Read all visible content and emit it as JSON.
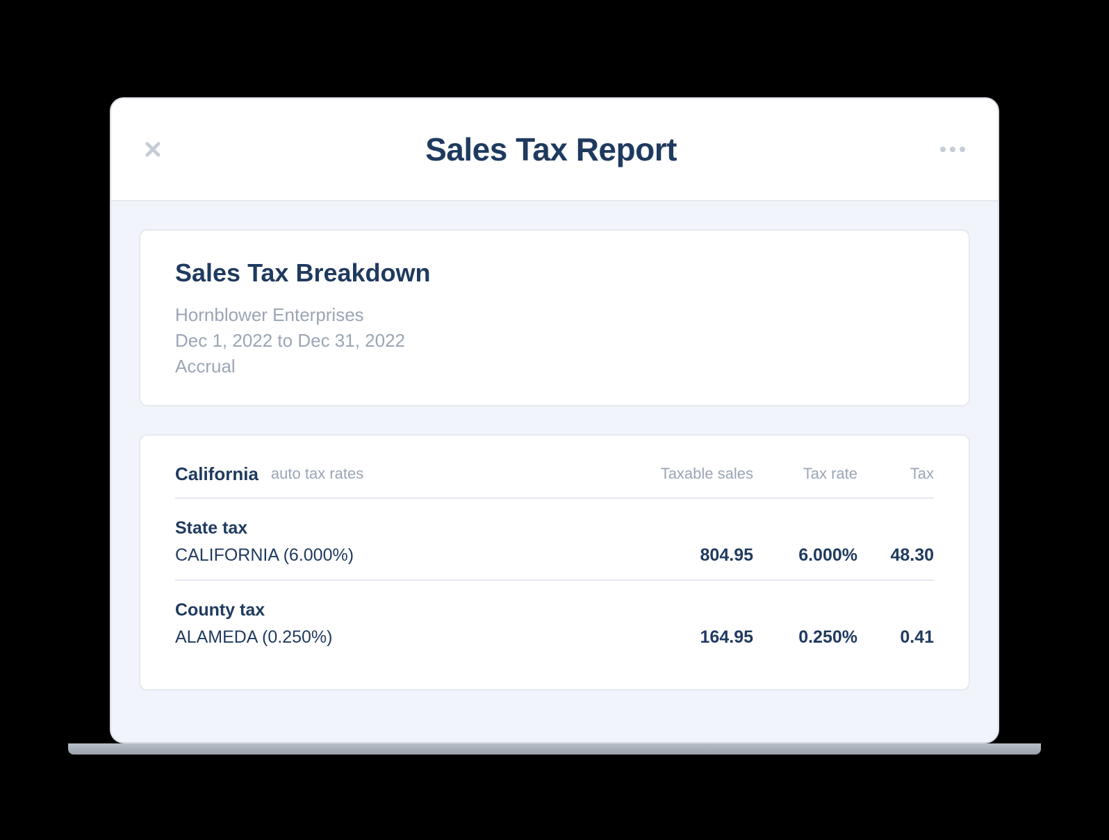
{
  "header": {
    "title": "Sales Tax Report"
  },
  "summary": {
    "title": "Sales Tax Breakdown",
    "company": "Hornblower Enterprises",
    "date_range": "Dec 1, 2022 to Dec 31, 2022",
    "method": "Accrual"
  },
  "table": {
    "state": "California",
    "rates_label": "auto tax rates",
    "columns": {
      "taxable": "Taxable sales",
      "rate": "Tax rate",
      "tax": "Tax"
    },
    "sections": [
      {
        "title": "State tax",
        "rows": [
          {
            "label": "CALIFORNIA (6.000%)",
            "taxable": "804.95",
            "rate": "6.000%",
            "tax": "48.30"
          }
        ]
      },
      {
        "title": "County tax",
        "rows": [
          {
            "label": "ALAMEDA (0.250%)",
            "taxable": "164.95",
            "rate": "0.250%",
            "tax": "0.41"
          }
        ]
      }
    ]
  }
}
